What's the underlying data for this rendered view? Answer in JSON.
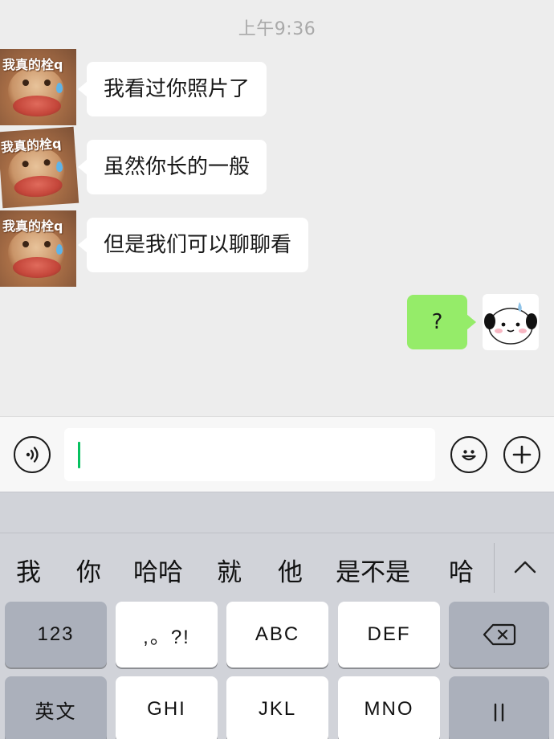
{
  "chat": {
    "timestamp": "上午9:36",
    "incoming": [
      {
        "text": "我看过你照片了",
        "avatar_caption": "我真的栓q"
      },
      {
        "text": "虽然你长的一般",
        "avatar_caption": "我真的栓q"
      },
      {
        "text": "但是我们可以聊聊看",
        "avatar_caption": "我真的栓q"
      }
    ],
    "outgoing": [
      {
        "text": "?"
      }
    ],
    "bubble_colors": {
      "incoming": "#ffffff",
      "outgoing": "#95ec69"
    }
  },
  "input_bar": {
    "voice_icon": "voice-icon",
    "text_value": "",
    "emoji_icon": "emoji-icon",
    "plus_icon": "plus-icon",
    "caret_color": "#07c160"
  },
  "keyboard": {
    "candidates": [
      "我",
      "你",
      "哈哈",
      "就",
      "他",
      "是不是",
      "哈"
    ],
    "collapse_icon": "chevron-up-icon",
    "row1": [
      "123",
      ",。?!",
      "ABC",
      "DEF"
    ],
    "row2": [
      "英文",
      "GHI",
      "JKL",
      "MNO"
    ],
    "delete_icon": "backspace-icon"
  }
}
